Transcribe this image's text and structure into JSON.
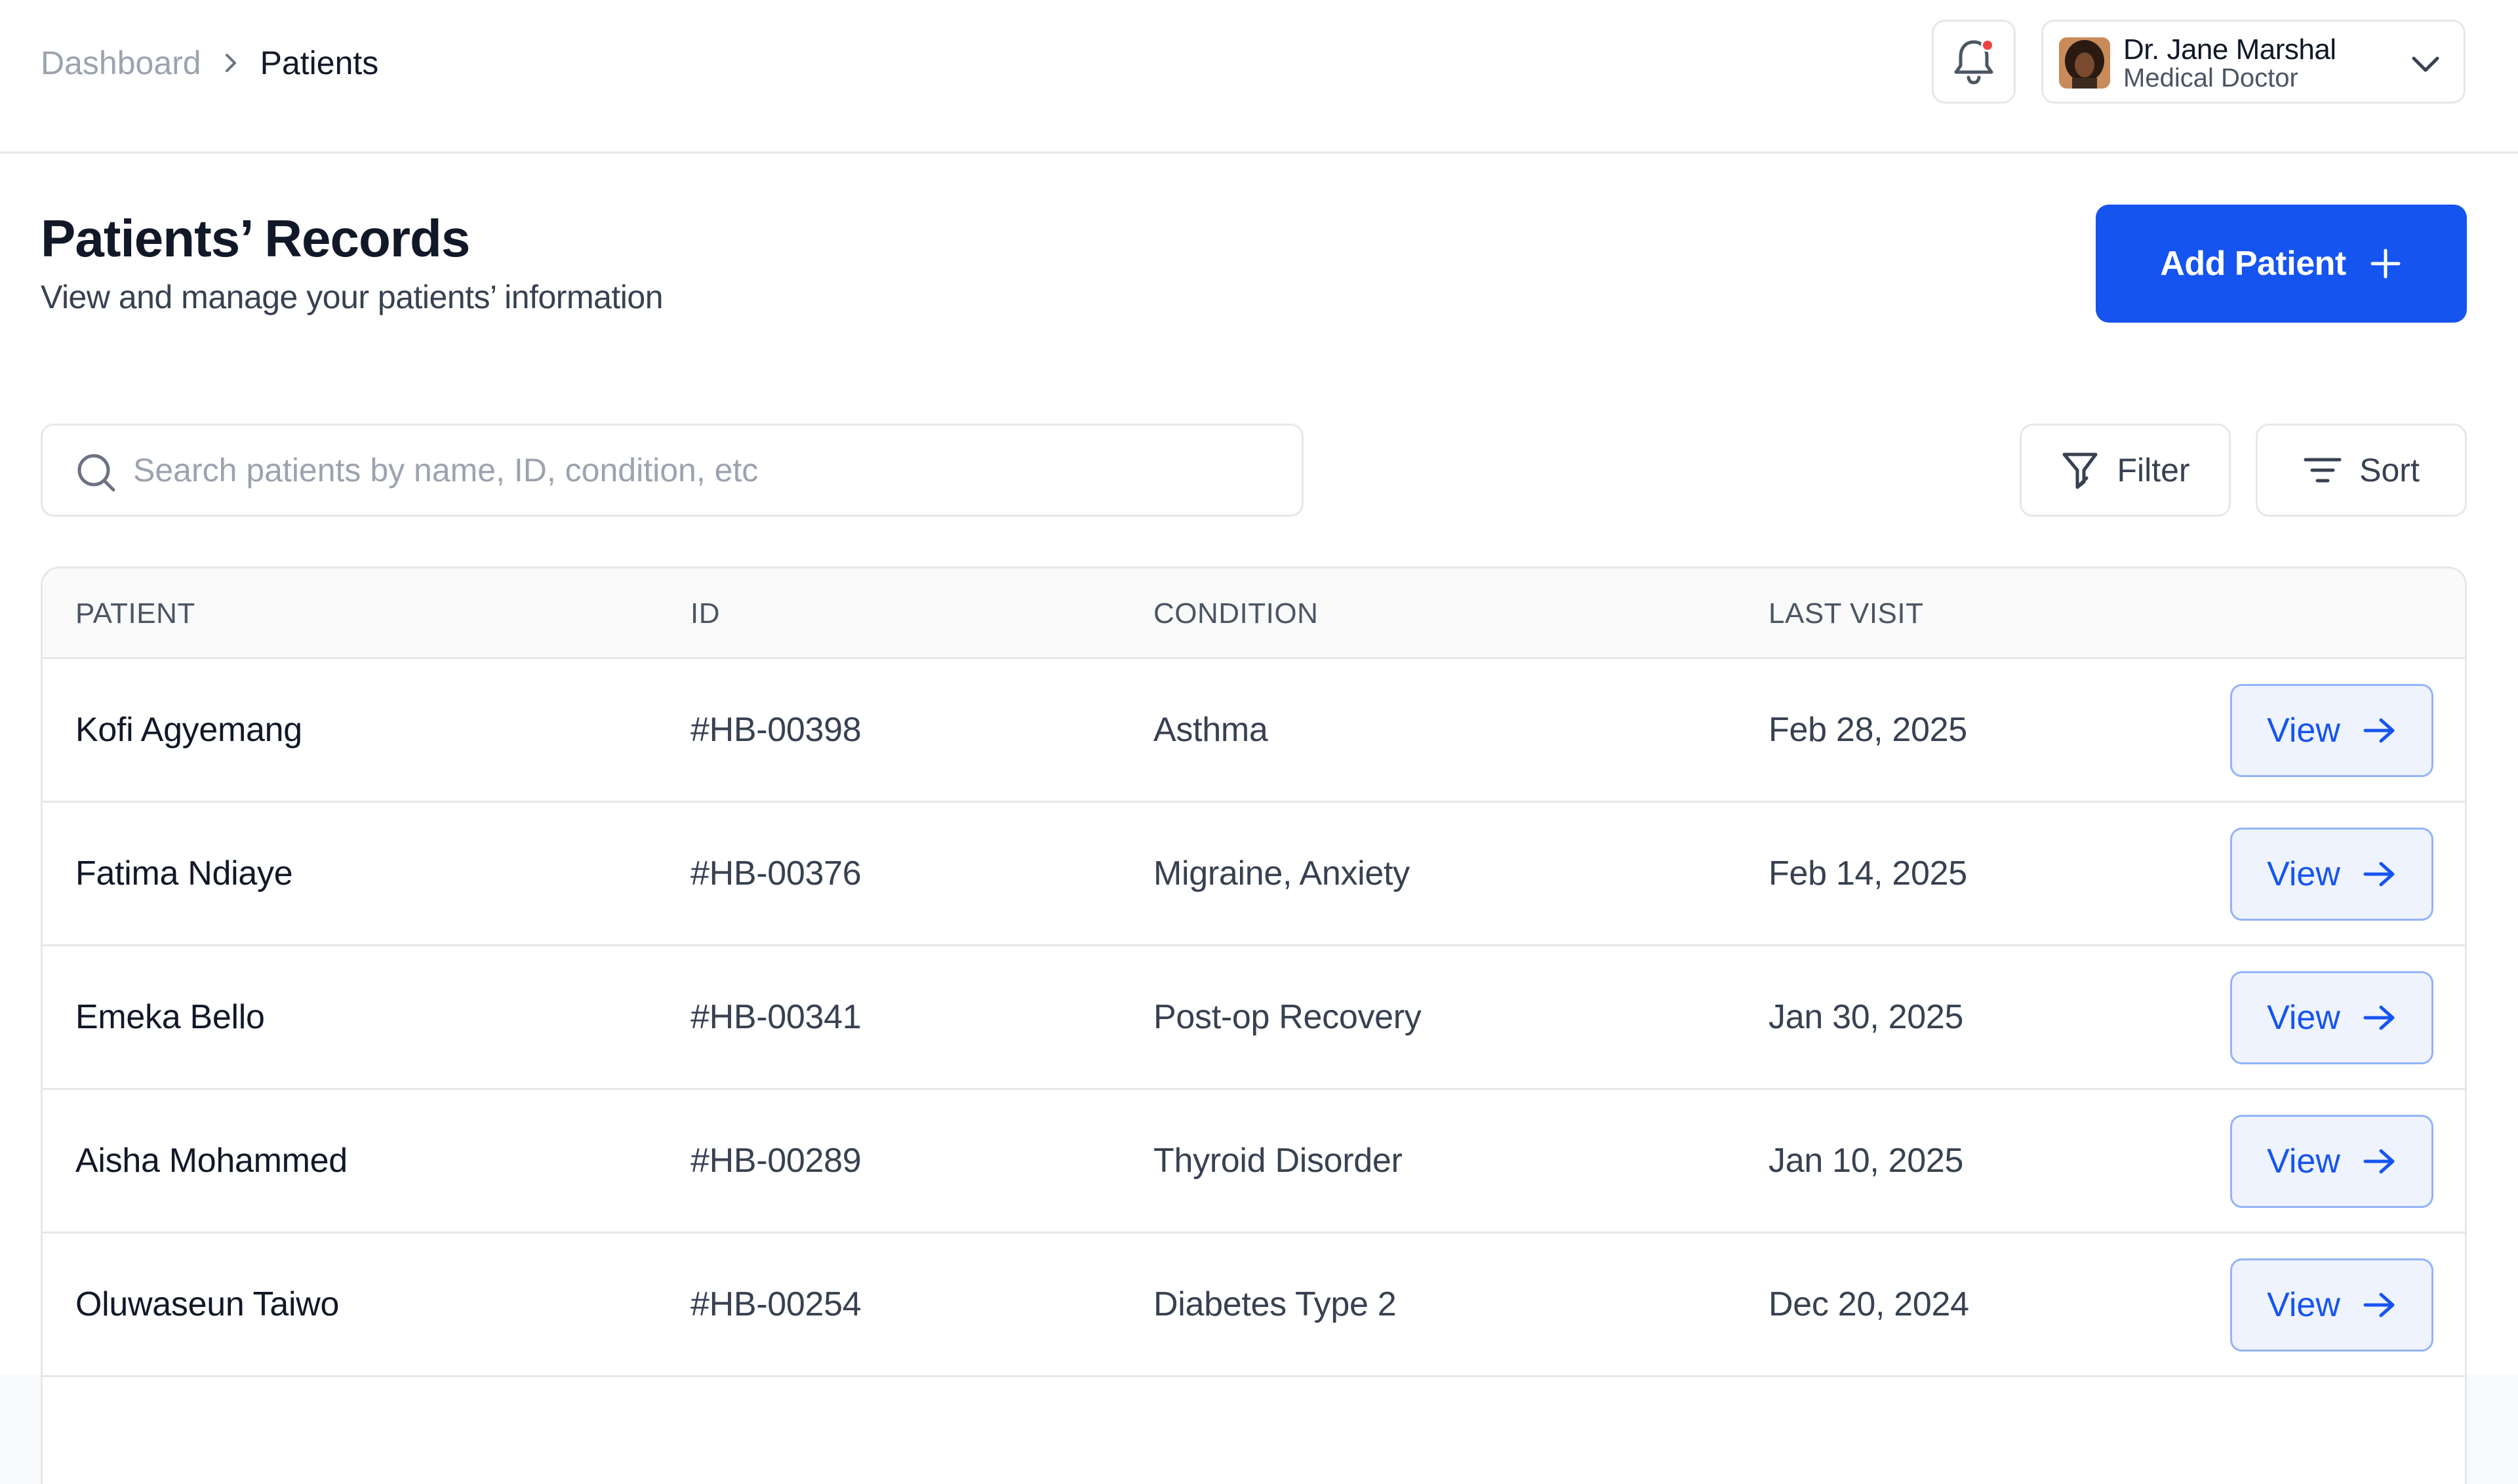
{
  "breadcrumb": {
    "parent": "Dashboard",
    "current": "Patients"
  },
  "user": {
    "name": "Dr. Jane Marshal",
    "role": "Medical Doctor"
  },
  "page": {
    "title": "Patients’ Records",
    "subtitle": "View and manage your patients’ information",
    "add_button": "Add Patient"
  },
  "search": {
    "placeholder": "Search patients by name, ID, condition, etc"
  },
  "toolbar": {
    "filter_label": "Filter",
    "sort_label": "Sort"
  },
  "table": {
    "columns": [
      "PATIENT",
      "ID",
      "CONDITION",
      "LAST VISIT"
    ],
    "view_label": "View",
    "rows": [
      {
        "patient": "Kofi Agyemang",
        "id": "#HB-00398",
        "condition": "Asthma",
        "last_visit": "Feb 28, 2025"
      },
      {
        "patient": "Fatima Ndiaye",
        "id": "#HB-00376",
        "condition": "Migraine, Anxiety",
        "last_visit": "Feb 14, 2025"
      },
      {
        "patient": "Emeka Bello",
        "id": "#HB-00341",
        "condition": "Post-op Recovery",
        "last_visit": "Jan 30, 2025"
      },
      {
        "patient": "Aisha Mohammed",
        "id": "#HB-00289",
        "condition": "Thyroid Disorder",
        "last_visit": "Jan 10, 2025"
      },
      {
        "patient": "Oluwaseun Taiwo",
        "id": "#HB-00254",
        "condition": "Diabetes Type 2",
        "last_visit": "Dec 20, 2024"
      }
    ]
  },
  "icons": {
    "breadcrumb_separator": "chevron-right-icon",
    "notifications": "bell-icon",
    "user_menu": "chevron-down-icon",
    "add": "plus-icon",
    "search": "search-icon",
    "filter": "filter-icon",
    "sort": "sort-icon",
    "view": "arrow-right-icon"
  },
  "colors": {
    "primary": "#1654f0",
    "notification_dot": "#ef4444",
    "view_button_bg": "#eef3fe",
    "border": "#e5e7eb"
  }
}
